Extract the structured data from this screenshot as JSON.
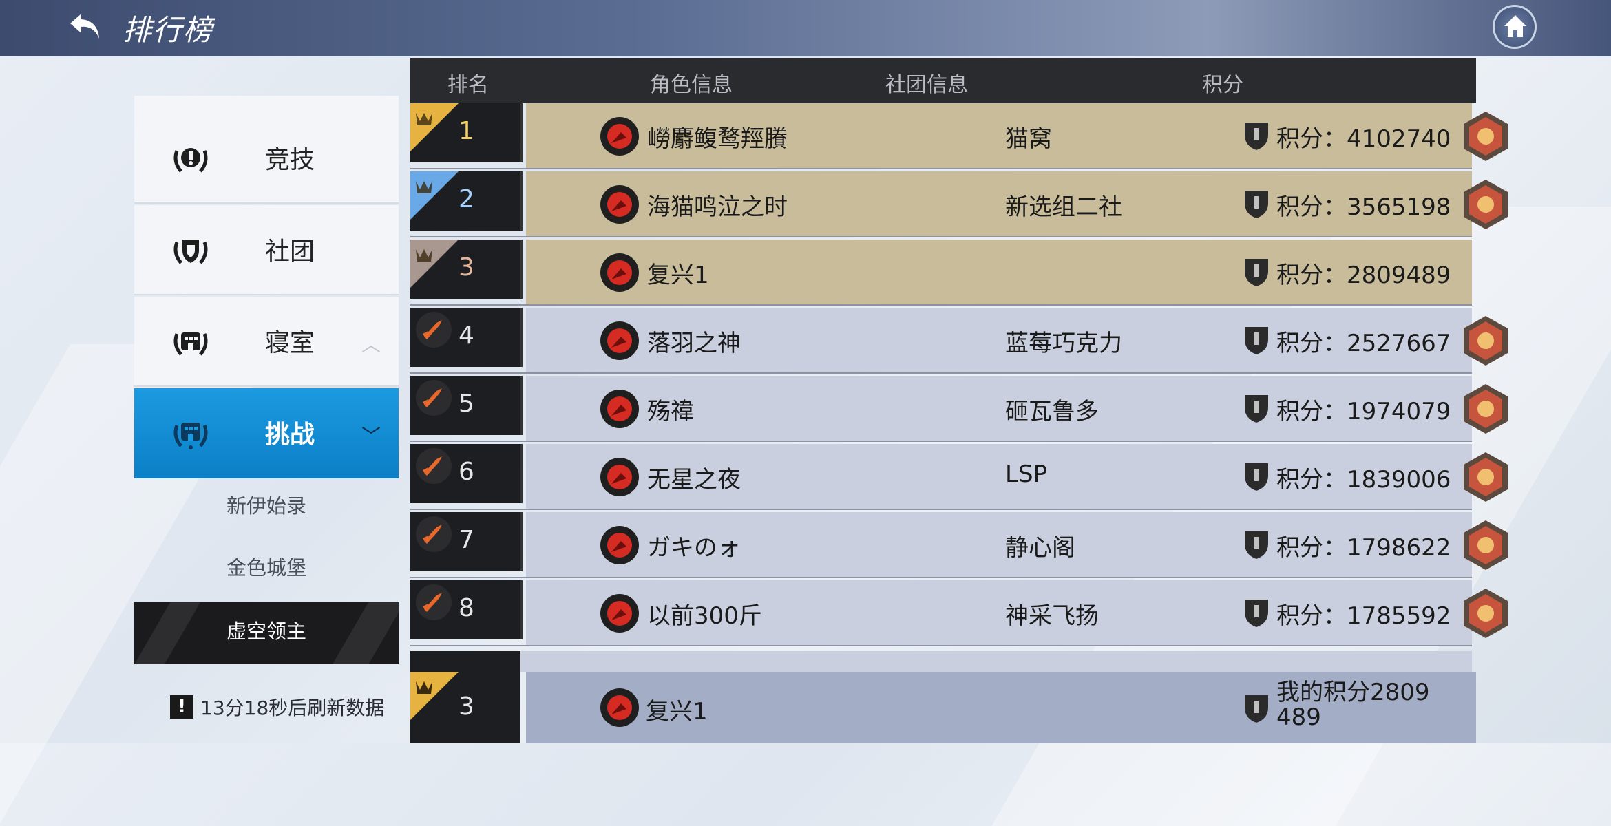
{
  "header": {
    "title": "排行榜",
    "back_icon": "back-arrow-icon",
    "home_icon": "home-icon"
  },
  "table": {
    "headers": {
      "rank": "排名",
      "role": "角色信息",
      "guild": "社团信息",
      "score": "积分"
    }
  },
  "menu": {
    "items": [
      {
        "label": "竞技",
        "icon": "laurel-trophy-icon"
      },
      {
        "label": "社团",
        "icon": "laurel-shield-icon"
      },
      {
        "label": "寝室",
        "icon": "laurel-house-icon"
      },
      {
        "label": "挑战",
        "icon": "laurel-building-icon"
      }
    ],
    "sub_items": [
      "新伊始录",
      "金色城堡",
      "虚空领主"
    ],
    "selected_sub": "虚空领主",
    "refresh_text": "13分18秒后刷新数据"
  },
  "rows": [
    {
      "rank": "1",
      "name": "嶗麝鳆鹜羥賸",
      "guild": "猫窝",
      "score": "积分：4102740",
      "tier": "gold"
    },
    {
      "rank": "2",
      "name": "海猫鸣泣之时",
      "guild": "新选组二社",
      "score": "积分：3565198",
      "tier": "silver"
    },
    {
      "rank": "3",
      "name": "复兴1",
      "guild": "",
      "score": "积分：2809489",
      "tier": "bronze"
    },
    {
      "rank": "4",
      "name": "落羽之神",
      "guild": "蓝莓巧克力",
      "score": "积分：2527667",
      "tier": "normal"
    },
    {
      "rank": "5",
      "name": "殇禕",
      "guild": "砸瓦鲁多",
      "score": "积分：1974079",
      "tier": "normal"
    },
    {
      "rank": "6",
      "name": "无星之夜",
      "guild": "LSP",
      "score": "积分：1839006",
      "tier": "normal"
    },
    {
      "rank": "7",
      "name": "ガキのォ",
      "guild": "静心阁",
      "score": "积分：1798622",
      "tier": "normal"
    },
    {
      "rank": "8",
      "name": "以前300斤",
      "guild": "神采飞扬",
      "score": "积分：1785592",
      "tier": "normal"
    }
  ],
  "my_row": {
    "rank": "3",
    "name": "复兴1",
    "score": "我的积分2809489"
  },
  "colors": {
    "gold_row": "#c8bc9a",
    "normal_row": "#c9cfdf",
    "my_row": "#a3aec6",
    "active_menu": "#1c9ae0",
    "header": "#2a2b2e"
  }
}
